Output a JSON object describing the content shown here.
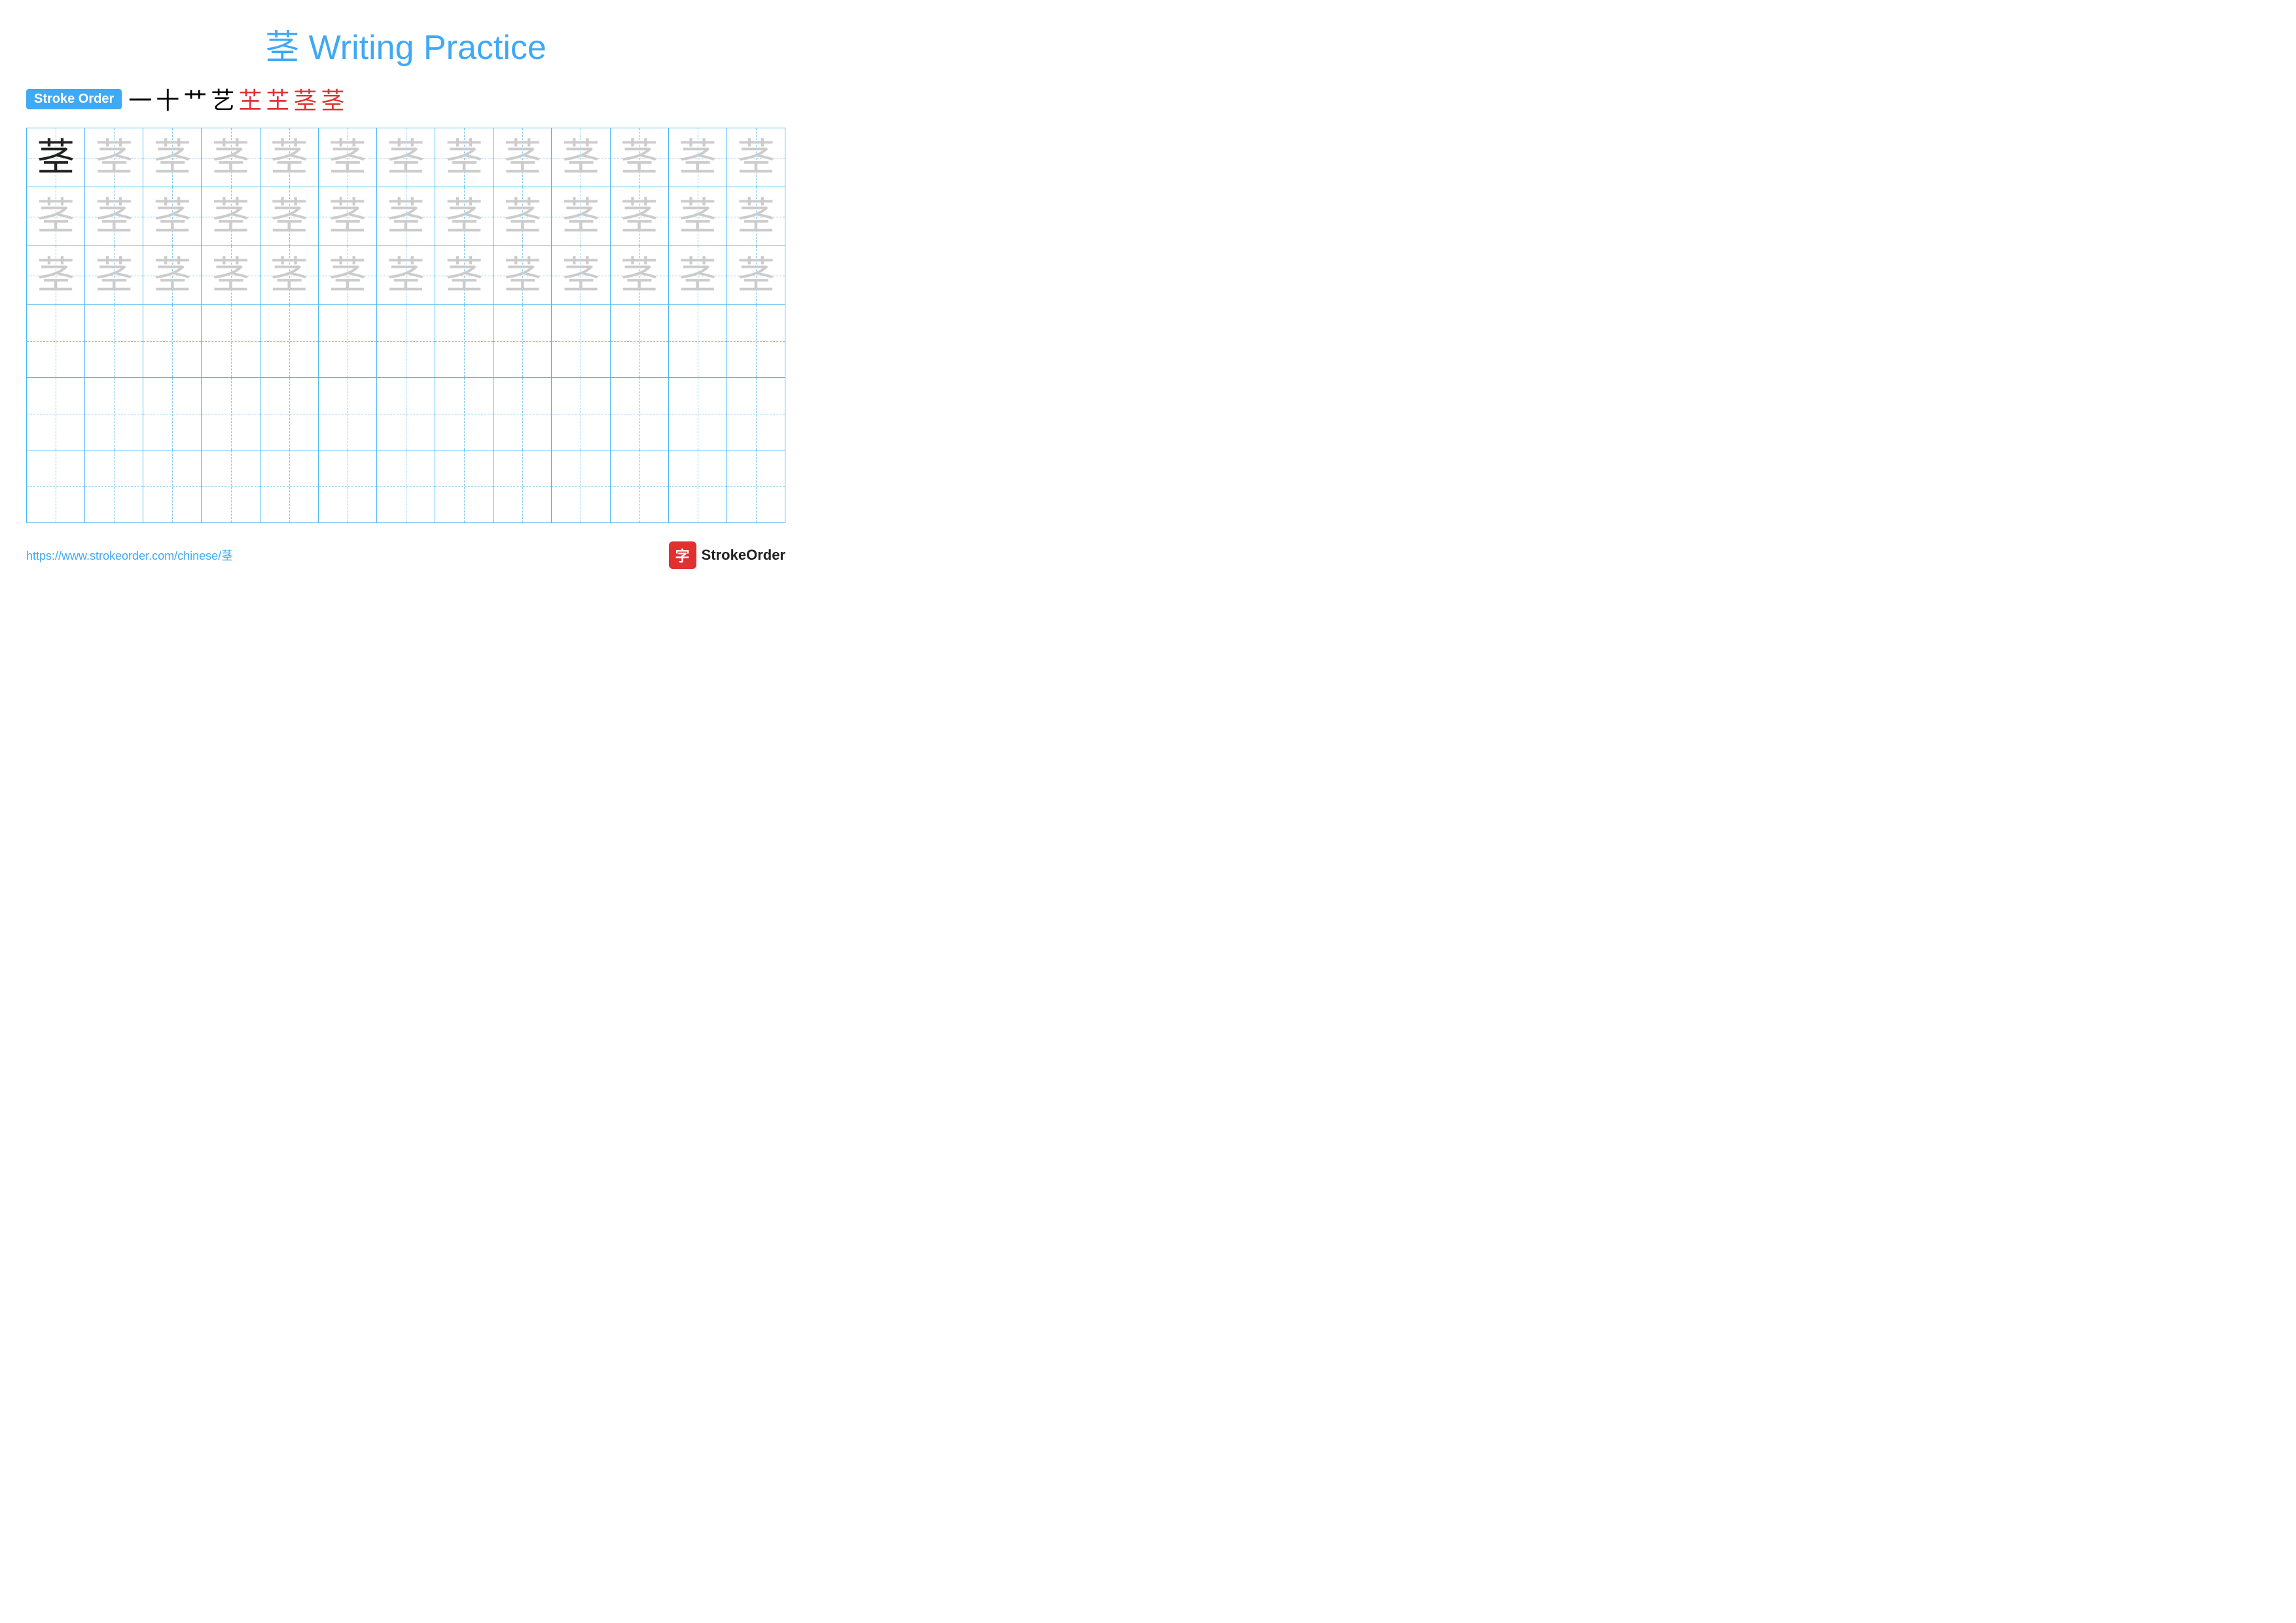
{
  "title": {
    "char": "茎",
    "text": "Writing Practice",
    "full": "茎 Writing Practice"
  },
  "stroke_order": {
    "badge_label": "Stroke Order",
    "strokes": [
      {
        "char": "一",
        "color": "black"
      },
      {
        "char": "十",
        "color": "black"
      },
      {
        "char": "艹",
        "color": "black"
      },
      {
        "char": "艺",
        "color": "black"
      },
      {
        "char": "芏",
        "color": "red"
      },
      {
        "char": "芏",
        "color": "red"
      },
      {
        "char": "茎",
        "color": "red"
      },
      {
        "char": "茎",
        "color": "red"
      }
    ]
  },
  "grid": {
    "cols": 13,
    "practice_char": "茎",
    "rows": [
      {
        "type": "practice",
        "first_dark": true
      },
      {
        "type": "practice",
        "first_dark": false
      },
      {
        "type": "practice",
        "first_dark": false
      },
      {
        "type": "empty"
      },
      {
        "type": "empty"
      },
      {
        "type": "empty"
      }
    ]
  },
  "footer": {
    "url": "https://www.strokeorder.com/chinese/茎",
    "brand_label": "StrokeOrder",
    "brand_char": "字"
  }
}
